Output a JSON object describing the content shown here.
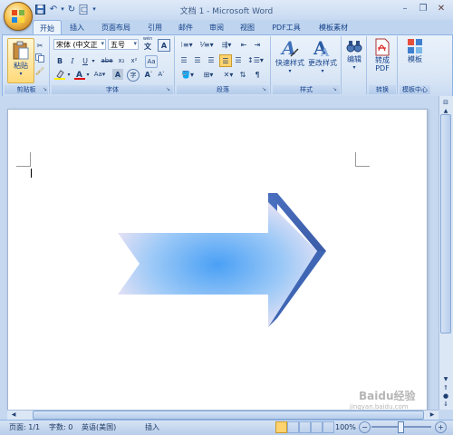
{
  "window": {
    "title": "文档 1 - Microsoft Word"
  },
  "quick_access": [
    "save-icon",
    "undo-icon",
    "redo-icon",
    "customize-icon"
  ],
  "tabs": [
    {
      "label": "开始",
      "active": true
    },
    {
      "label": "插入"
    },
    {
      "label": "页面布局"
    },
    {
      "label": "引用"
    },
    {
      "label": "邮件"
    },
    {
      "label": "审阅"
    },
    {
      "label": "视图"
    },
    {
      "label": "PDF工具"
    },
    {
      "label": "模板素材"
    }
  ],
  "ribbon": {
    "clipboard": {
      "label": "剪贴板",
      "paste": "粘贴"
    },
    "font": {
      "label": "字体",
      "font_name": "宋体 (中文正",
      "font_size": "五号",
      "wen": "文",
      "pinyin": "wén"
    },
    "paragraph": {
      "label": "段落"
    },
    "styles": {
      "label": "样式",
      "quick_styles": "快速样式",
      "change_styles": "更改样式"
    },
    "editing": {
      "label": "编辑"
    },
    "convert": {
      "label": "转换",
      "button": "转成PDF"
    },
    "template": {
      "label": "模板中心",
      "button": "模板"
    }
  },
  "document": {
    "shape": "arrow-shape",
    "arrow_colors": {
      "dark": "#4a6fbf",
      "light": "#eaf1fb",
      "center": "#4aa0f5",
      "edge": "#f2e6f4"
    }
  },
  "statusbar": {
    "page": "页面: 1/1",
    "words": "字数: 0",
    "language": "英语(美国)",
    "mode": "插入",
    "zoom": "100%"
  },
  "watermark": {
    "text": "Baidu经验",
    "sub": "jingyan.baidu.com"
  }
}
